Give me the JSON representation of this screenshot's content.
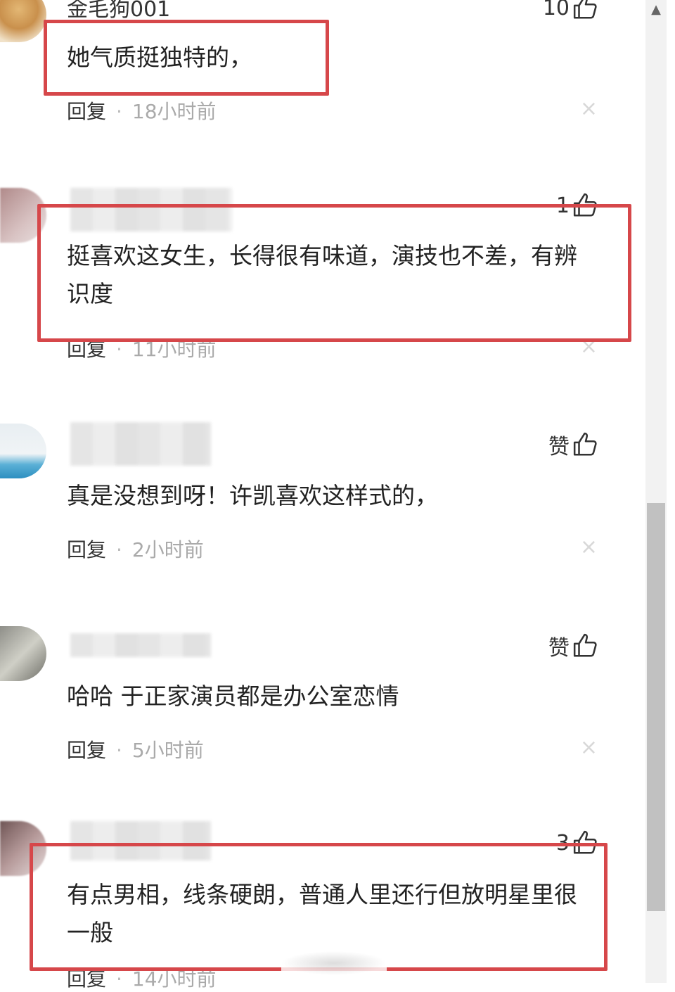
{
  "comments": [
    {
      "username": "金毛狗001",
      "likes": "10",
      "text": "她气质挺独特的，",
      "reply_label": "回复",
      "time": "18小时前"
    },
    {
      "username": "",
      "likes": "1",
      "text": "挺喜欢这女生，长得很有味道，演技也不差，有辨识度",
      "reply_label": "回复",
      "time": "11小时前"
    },
    {
      "username": "",
      "likes": "赞",
      "text": "真是没想到呀！许凯喜欢这样式的，",
      "reply_label": "回复",
      "time": "2小时前"
    },
    {
      "username": "",
      "likes": "赞",
      "text": "哈哈 于正家演员都是办公室恋情",
      "reply_label": "回复",
      "time": "5小时前"
    },
    {
      "username": "",
      "likes": "3",
      "text": "有点男相，线条硬朗，普通人里还行但放明星里很一般",
      "reply_label": "回复",
      "time": "14小时前"
    }
  ],
  "separator": "·",
  "close_symbol": "×",
  "scroll_up_symbol": "▲",
  "colors": {
    "highlight": "#d6474a",
    "meta_time": "#aaaaaa"
  },
  "icons": {
    "like": "thumbs-up-icon",
    "close": "close-icon"
  }
}
